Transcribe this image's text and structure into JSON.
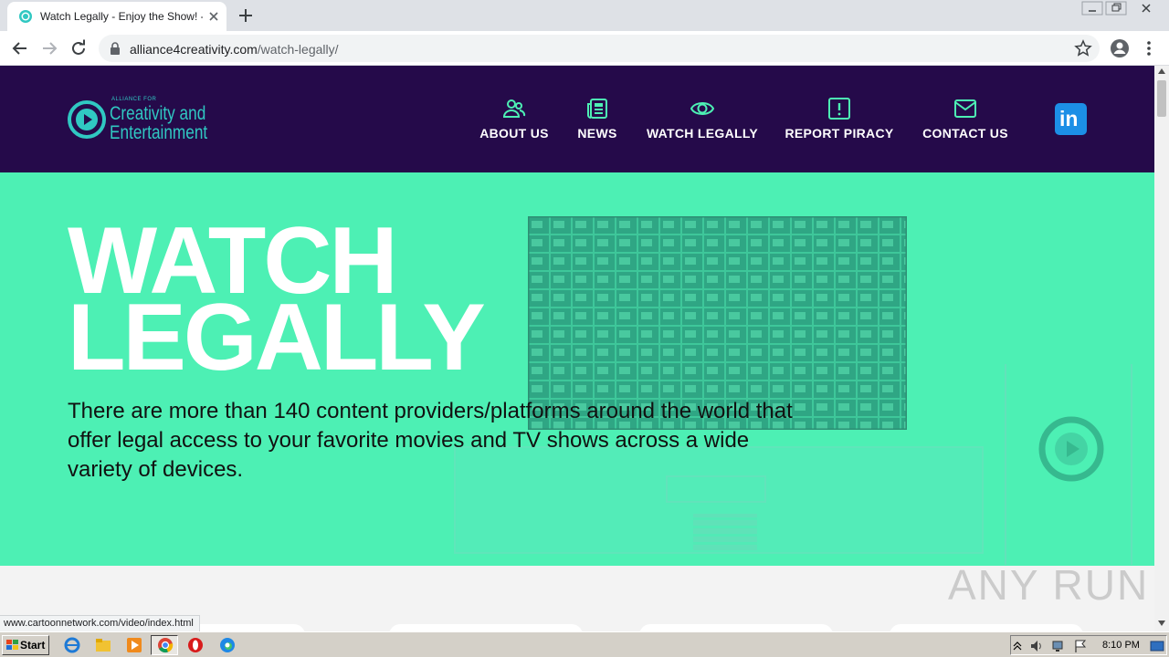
{
  "browser": {
    "tab_title": "Watch Legally - Enjoy the Show! - A",
    "url_host": "alliance4creativity.com",
    "url_path": "/watch-legally/",
    "status_url": "www.cartoonnetwork.com/video/index.html"
  },
  "site": {
    "logo": {
      "small": "ALLIANCE FOR",
      "line1": "Creativity and",
      "line2": "Entertainment"
    },
    "nav": [
      {
        "label": "ABOUT US",
        "icon": "users-icon"
      },
      {
        "label": "NEWS",
        "icon": "newspaper-icon"
      },
      {
        "label": "WATCH LEGALLY",
        "icon": "eye-icon"
      },
      {
        "label": "REPORT PIRACY",
        "icon": "alert-icon"
      },
      {
        "label": "CONTACT US",
        "icon": "mail-icon"
      }
    ],
    "linkedin_label": "in",
    "hero": {
      "title_line1": "WATCH",
      "title_line2": "LEGALLY",
      "text": "There are more than 140 content providers/platforms around the world that offer legal access to your favorite movies and TV shows across a wide variety of devices."
    },
    "watermark": "ANY RUN"
  },
  "taskbar": {
    "start_label": "Start",
    "clock": "8:10 PM"
  },
  "colors": {
    "header": "#250a4a",
    "hero": "#4df0b4",
    "accent": "#30c8c2",
    "linkedin": "#1c8fe6"
  }
}
